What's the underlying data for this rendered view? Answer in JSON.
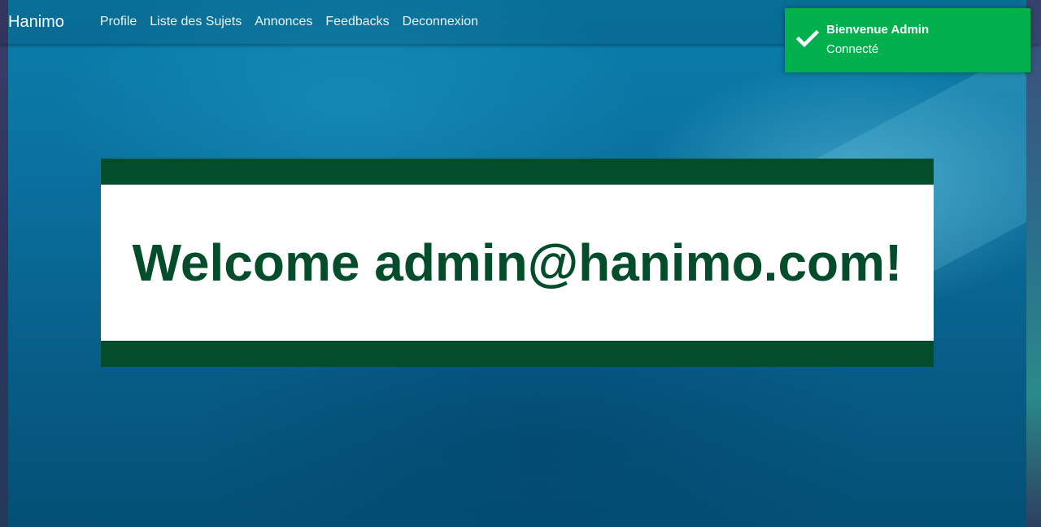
{
  "navbar": {
    "brand": "Hanimo",
    "links": [
      "Profile",
      "Liste des Sujets",
      "Annonces",
      "Feedbacks",
      "Deconnexion"
    ]
  },
  "welcome": {
    "text": "Welcome admin@hanimo.com!"
  },
  "toast": {
    "icon": "checkmark-icon",
    "title": "Bienvenue Admin",
    "message": "Connecté"
  },
  "colors": {
    "brand_green": "#034d2b",
    "toast_green": "#00b04c",
    "background_blue": "#0a6f9d"
  }
}
